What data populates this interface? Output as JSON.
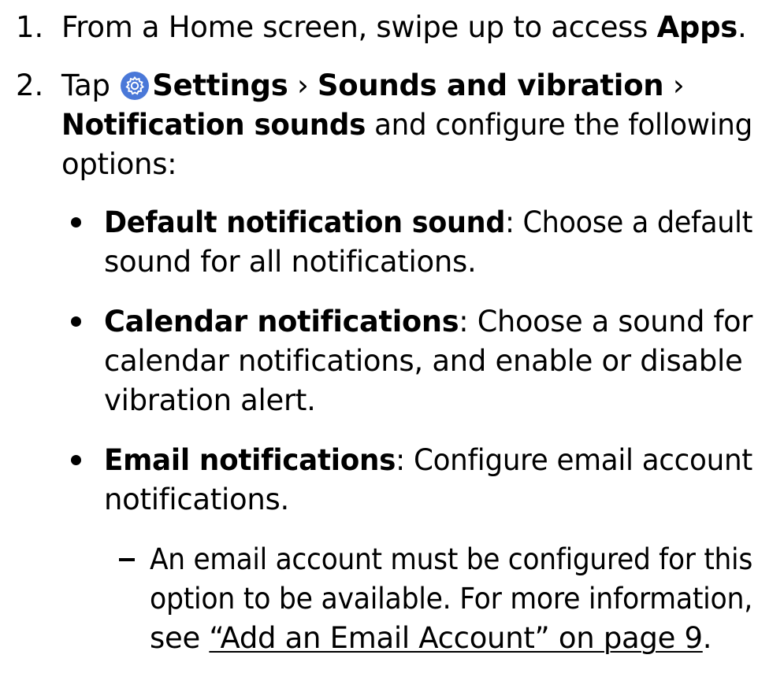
{
  "steps": [
    {
      "number": "1.",
      "text_pre": "From a Home screen, swipe up to access ",
      "apps": "Apps",
      "text_post": "."
    },
    {
      "number": "2.",
      "tap": "Tap",
      "settings": "Settings",
      "sep": "›",
      "sounds_vibration": "Sounds and vibration",
      "notification_sounds": "Notification sounds",
      "text_post": " and configure the following",
      "options": "options:"
    }
  ],
  "bullets": [
    {
      "title": "Default notification sound",
      "desc_line1": ": Choose a default",
      "desc_line2": "sound for all notifications."
    },
    {
      "title": "Calendar notifications",
      "desc_line1": ": Choose a sound for",
      "desc_line2": "calendar notifications, and enable or disable",
      "desc_line3": "vibration alert."
    },
    {
      "title": "Email notifications",
      "desc_line1": ": Configure email account",
      "desc_line2": "notifications."
    }
  ],
  "subnote": {
    "line1": "An email account must be configured for this",
    "line2": "option to be available. For more information,",
    "line3_pre": "see ",
    "link": "“Add an Email Account” on page 9",
    "line3_post": "."
  },
  "icons": {
    "settings": "gear-icon",
    "settings_color": "#4a78d8"
  }
}
